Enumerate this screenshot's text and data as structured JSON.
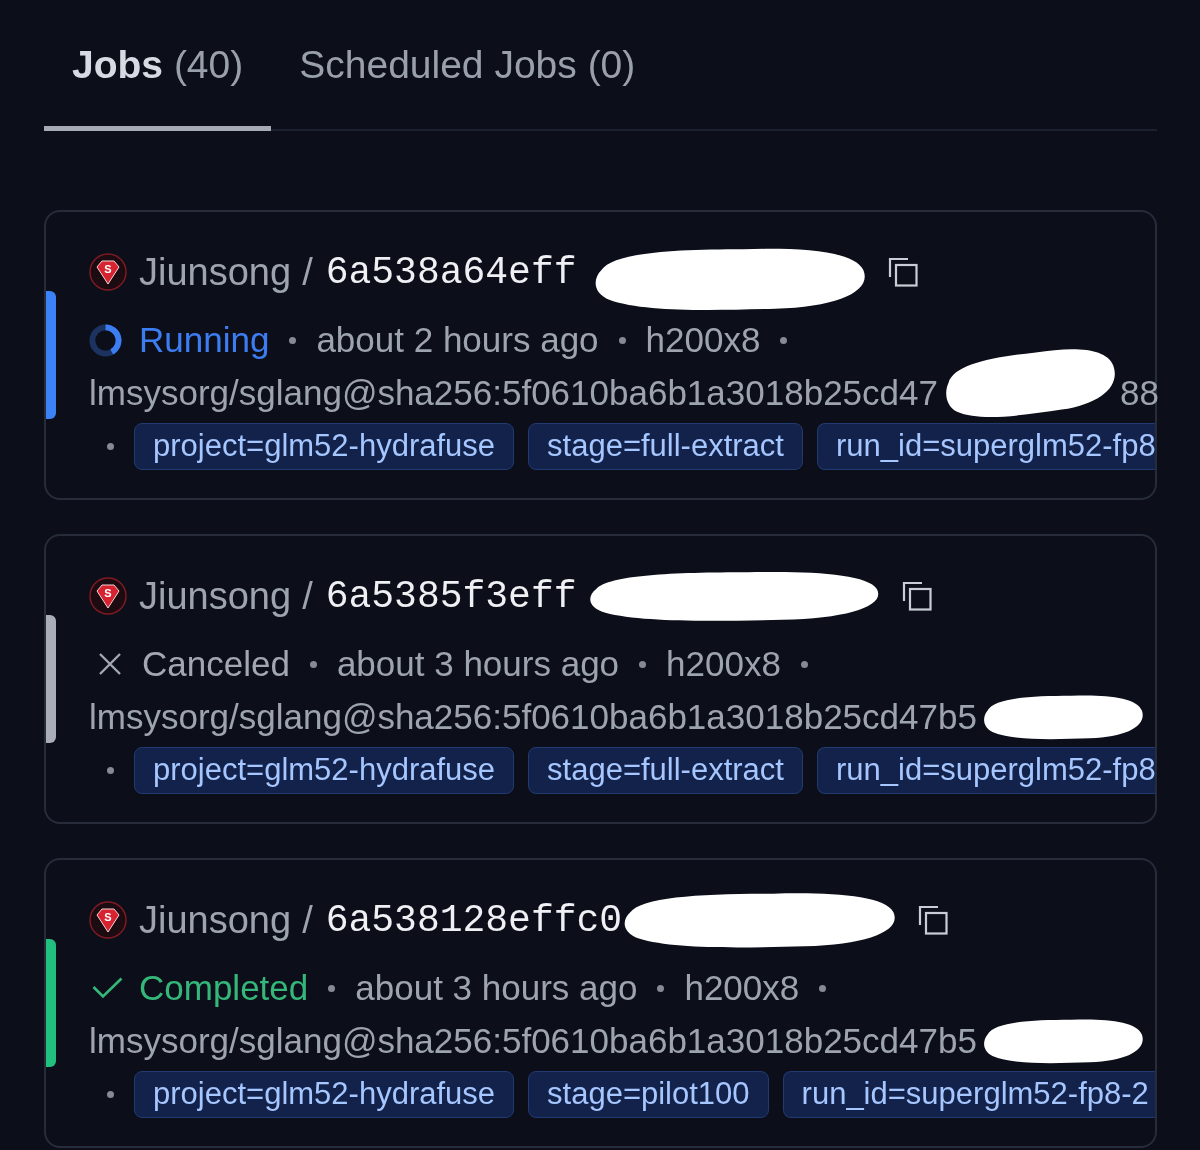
{
  "tabs": [
    {
      "label": "Jobs",
      "count": "(40)",
      "selected": true
    },
    {
      "label": "Scheduled Jobs",
      "count": "(0)",
      "selected": false
    }
  ],
  "jobs": [
    {
      "avatar_letter": "S",
      "owner": "Jiunsong",
      "separator": "/",
      "hash": "6a538a64eff",
      "status": {
        "kind": "running",
        "label": "Running"
      },
      "time": "about 2 hours ago",
      "machine": "h200x8",
      "image": "lmsysorg/sglang@sha256:5f0610ba6b1a3018b25cd47",
      "image_tail": "88",
      "tags": [
        "project=glm52-hydrafuse",
        "stage=full-extract",
        "run_id=superglm52-fp8"
      ]
    },
    {
      "avatar_letter": "S",
      "owner": "Jiunsong",
      "separator": "/",
      "hash": "6a5385f3eff",
      "status": {
        "kind": "canceled",
        "label": "Canceled"
      },
      "time": "about 3 hours ago",
      "machine": "h200x8",
      "image": "lmsysorg/sglang@sha256:5f0610ba6b1a3018b25cd47b5",
      "tags": [
        "project=glm52-hydrafuse",
        "stage=full-extract",
        "run_id=superglm52-fp8"
      ]
    },
    {
      "avatar_letter": "S",
      "owner": "Jiunsong",
      "separator": "/",
      "hash": "6a538128effc0",
      "status": {
        "kind": "completed",
        "label": "Completed"
      },
      "time": "about 3 hours ago",
      "machine": "h200x8",
      "image": "lmsysorg/sglang@sha256:5f0610ba6b1a3018b25cd47b5",
      "tags": [
        "project=glm52-hydrafuse",
        "stage=pilot100",
        "run_id=superglm52-fp8-2"
      ]
    }
  ]
}
